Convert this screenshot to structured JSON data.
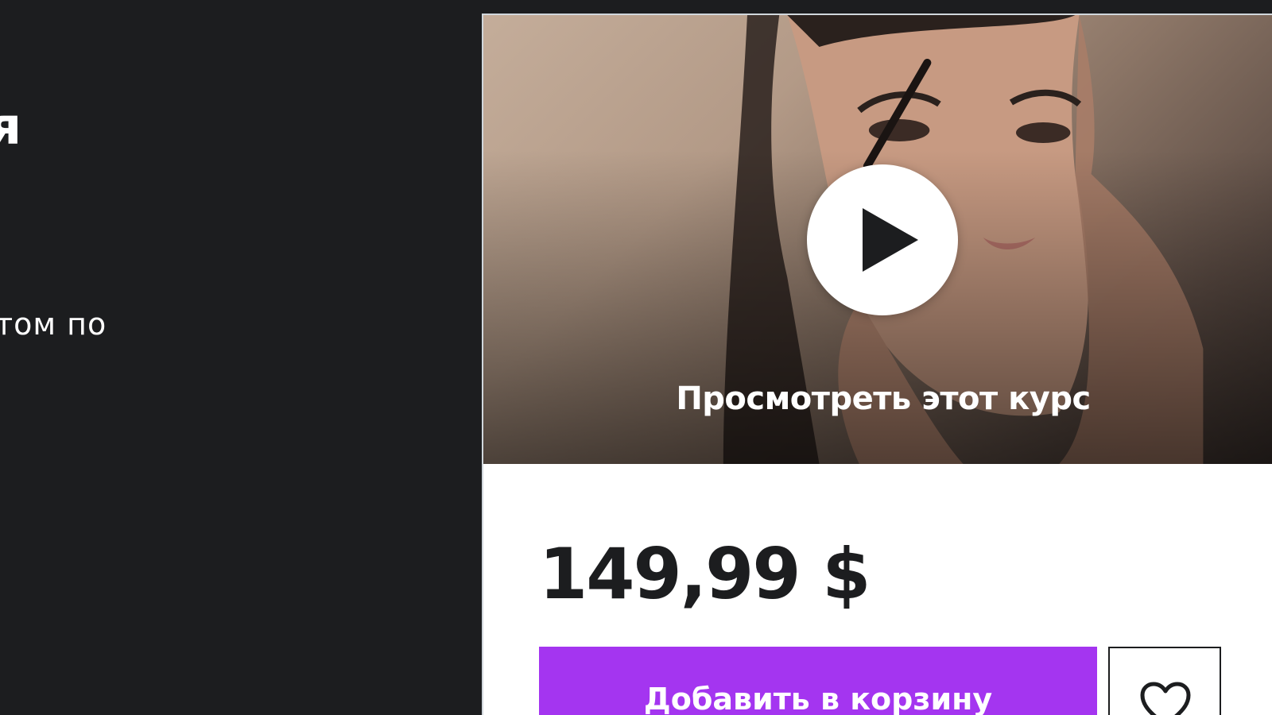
{
  "hero": {
    "title_fragment": "я",
    "subtitle_fragment": "том по"
  },
  "course_card": {
    "preview_label": "Просмотреть этот курс",
    "play_icon": "play-icon",
    "price": "149,99 $",
    "add_to_cart_label": "Добавить в корзину",
    "wishlist_icon": "heart-icon"
  },
  "colors": {
    "background_dark": "#1c1d1f",
    "accent_purple": "#a435f0",
    "card_border": "#d1d7dc",
    "text_dark": "#1c1d1f"
  }
}
